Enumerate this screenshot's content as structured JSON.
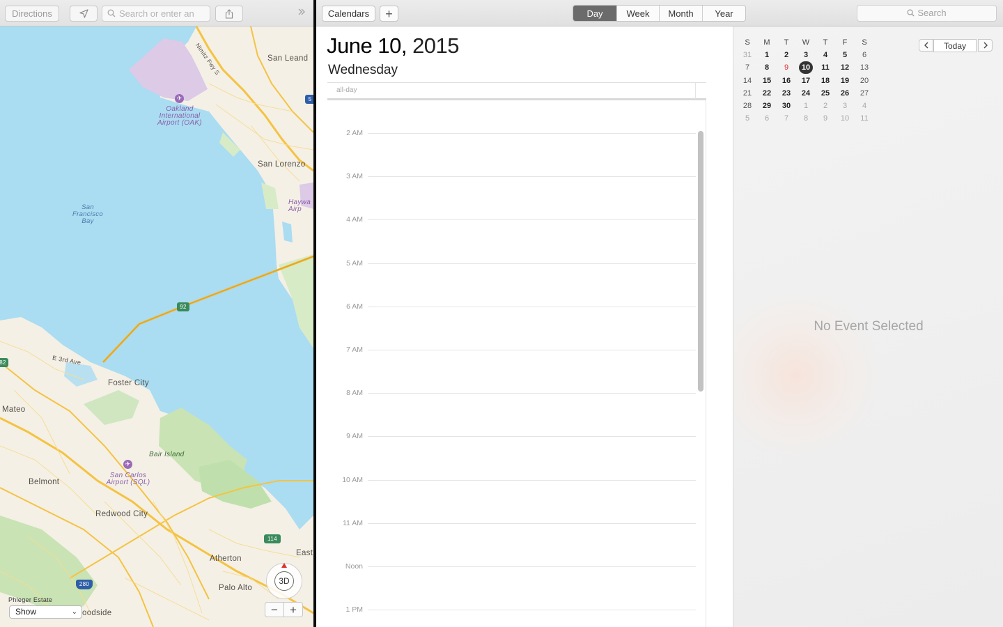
{
  "maps": {
    "toolbar": {
      "directions_label": "Directions",
      "search_placeholder": "Search or enter an",
      "location_icon": "location-arrow-icon",
      "share_icon": "share-icon",
      "more_icon": "chevron-double-right-icon"
    },
    "labels": {
      "san_leandro": "San Leand",
      "oakland_airport": "Oakland International Airport (OAK)",
      "nimitz": "Nimitz Fwy S",
      "san_lorenzo": "San Lorenzo",
      "hayward": "Haywa Airp",
      "sf_bay": "San Francisco Bay",
      "route_92": "92",
      "foster_city": "Foster City",
      "e_3rd_ave": "E 3rd Ave",
      "san_mateo": "Mateo",
      "bair_island": "Bair Island",
      "san_carlos_airport": "San Carlos Airport (SQL)",
      "belmont": "Belmont",
      "redwood_city": "Redwood City",
      "route_114": "114",
      "east": "East",
      "atherton": "Atherton",
      "palo_alto": "Palo Alto",
      "route_280": "280",
      "route_82": "82",
      "route_5": "5",
      "phleger": "Phleger Estate",
      "woodside": "oodside"
    },
    "controls": {
      "btn_3d": "3D",
      "zoom_out": "−",
      "zoom_in": "+",
      "show_label": "Show"
    }
  },
  "calendar": {
    "toolbar": {
      "calendars_label": "Calendars",
      "add_label": "+",
      "views": [
        "Day",
        "Week",
        "Month",
        "Year"
      ],
      "active_view": "Day",
      "search_placeholder": "Search"
    },
    "day_view": {
      "date_main": "June 10,",
      "date_year": "2015",
      "weekday": "Wednesday",
      "allday_label": "all-day",
      "hours": [
        "2 AM",
        "3 AM",
        "4 AM",
        "5 AM",
        "6 AM",
        "7 AM",
        "8 AM",
        "9 AM",
        "10 AM",
        "11 AM",
        "Noon",
        "1 PM"
      ]
    },
    "mini_calendar": {
      "weekdays": [
        "S",
        "M",
        "T",
        "W",
        "T",
        "F",
        "S"
      ],
      "weeks": [
        [
          "31",
          "1",
          "2",
          "3",
          "4",
          "5",
          "6"
        ],
        [
          "7",
          "8",
          "9",
          "10",
          "11",
          "12",
          "13"
        ],
        [
          "14",
          "15",
          "16",
          "17",
          "18",
          "19",
          "20"
        ],
        [
          "21",
          "22",
          "23",
          "24",
          "25",
          "26",
          "27"
        ],
        [
          "28",
          "29",
          "30",
          "1",
          "2",
          "3",
          "4"
        ],
        [
          "5",
          "6",
          "7",
          "8",
          "9",
          "10",
          "11"
        ]
      ],
      "today": "9",
      "selected": "10",
      "prev_icon": "chevron-left-icon",
      "today_label": "Today",
      "next_icon": "chevron-right-icon"
    },
    "inspector": {
      "empty_message": "No Event Selected"
    },
    "colors": {
      "today_red": "#e03131",
      "selected_dark": "#333333",
      "active_segment": "#6b6b6b"
    }
  }
}
